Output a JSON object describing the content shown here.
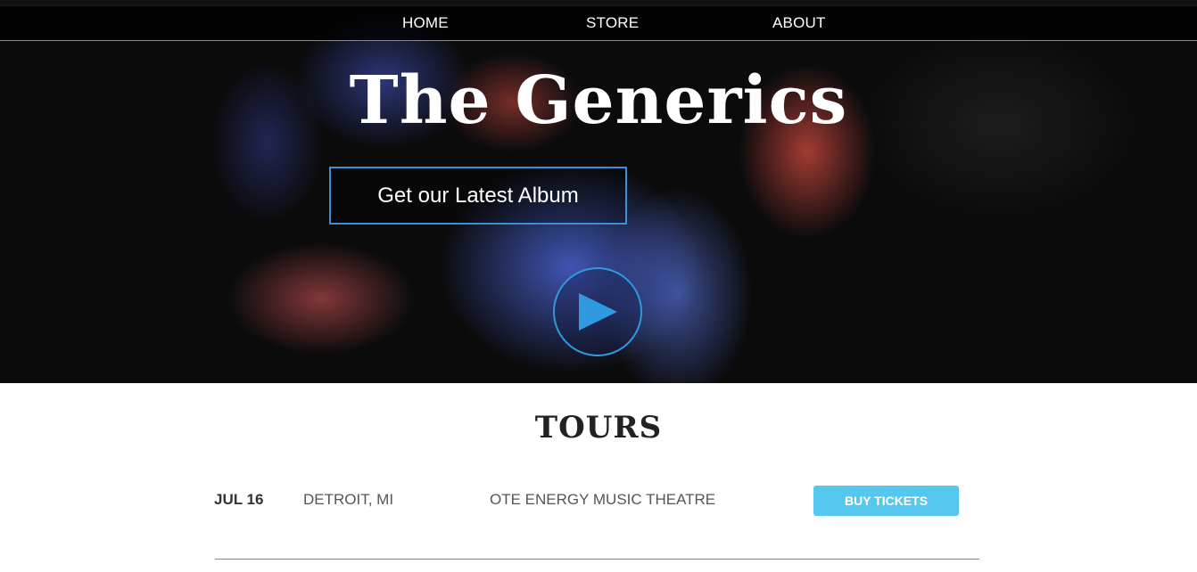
{
  "nav": {
    "items": [
      {
        "label": "HOME"
      },
      {
        "label": "STORE"
      },
      {
        "label": "ABOUT"
      }
    ]
  },
  "hero": {
    "title": "The Generics",
    "album_button_label": "Get our Latest Album",
    "play_icon": "play-icon",
    "accent_color": "#3b8fd6"
  },
  "tours": {
    "title": "TOURS",
    "rows": [
      {
        "date": "JUL 16",
        "city": "DETROIT, MI",
        "venue": "OTE ENERGY MUSIC THEATRE",
        "button_label": "BUY TICKETS",
        "button_color": "#56c8f0"
      }
    ]
  }
}
